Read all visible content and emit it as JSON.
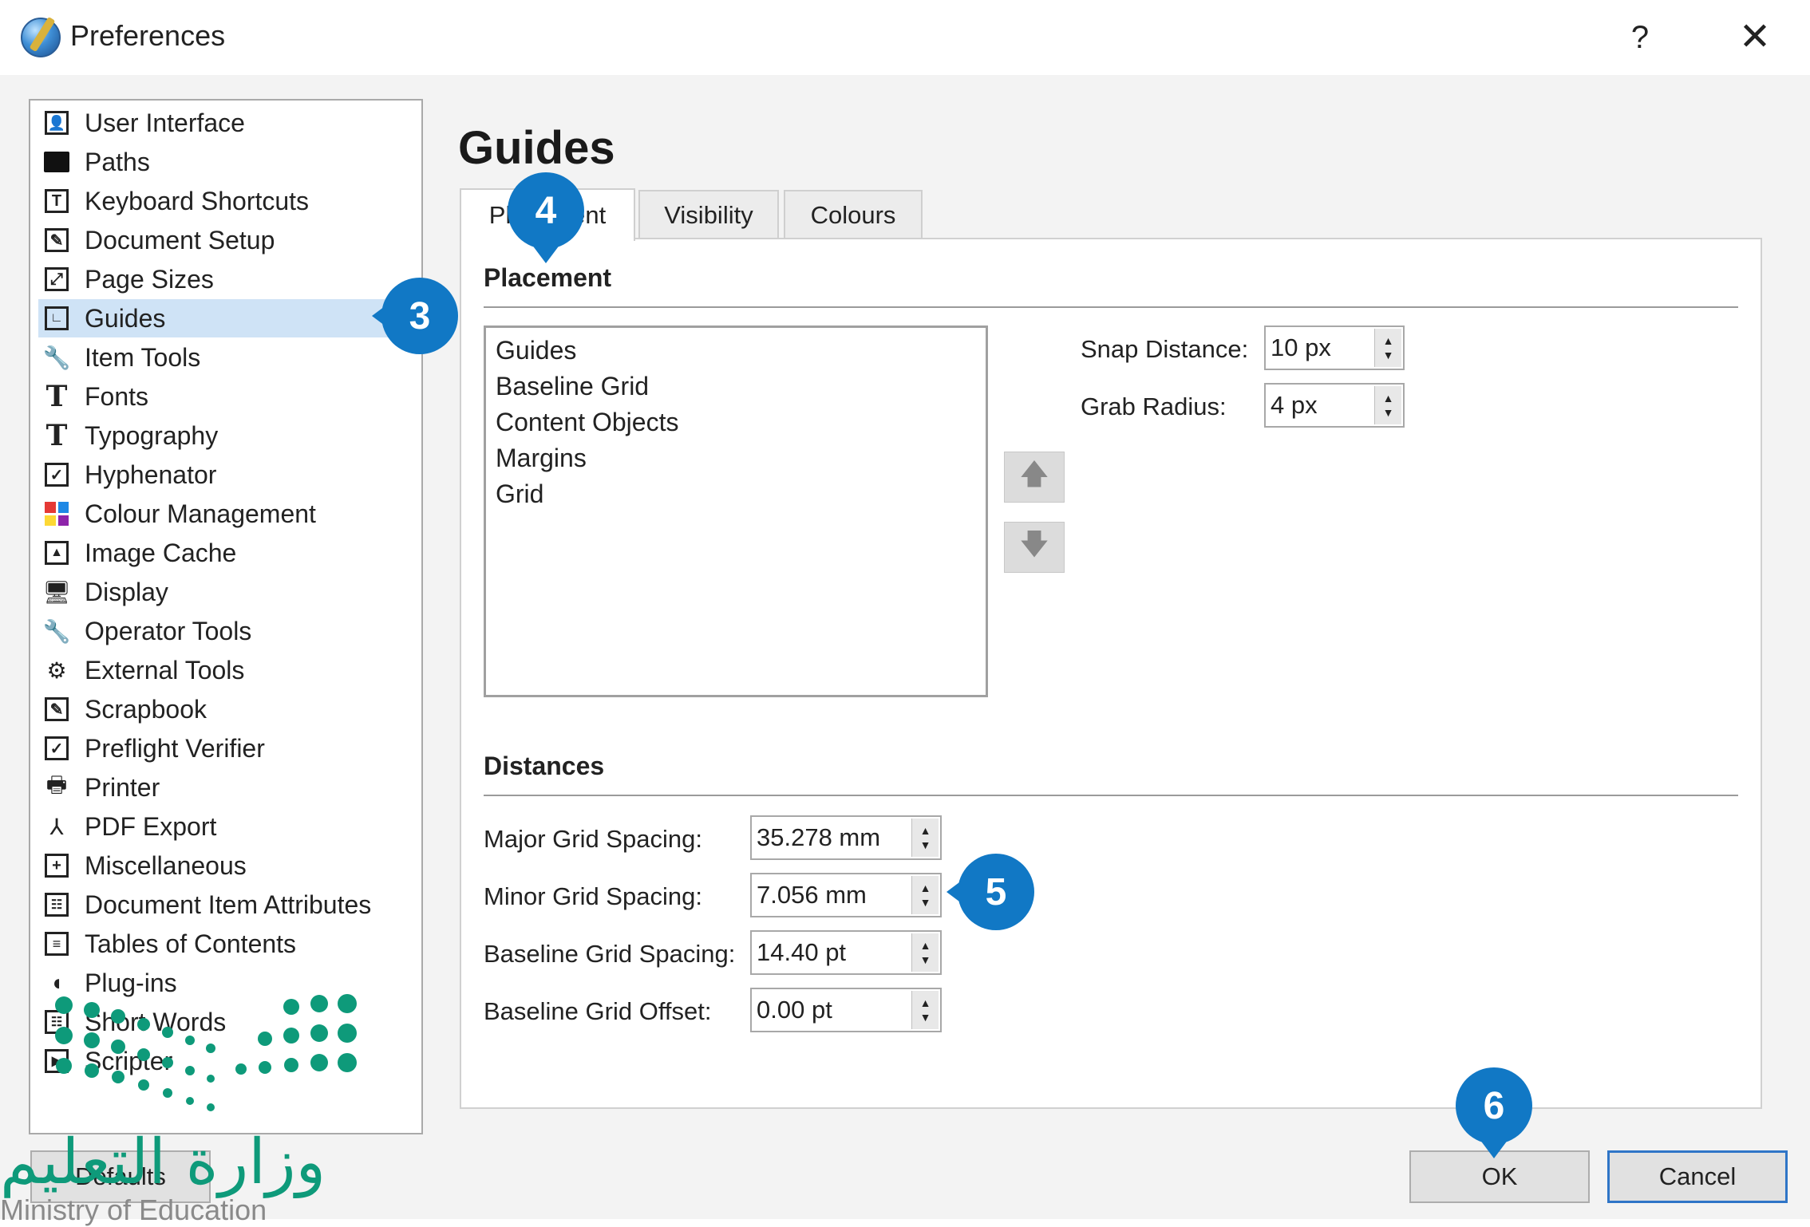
{
  "window": {
    "title": "Preferences",
    "help_glyph": "?",
    "close_glyph": "✕"
  },
  "sidebar": {
    "items": [
      {
        "label": "User Interface",
        "icon": "user-interface-icon"
      },
      {
        "label": "Paths",
        "icon": "folder-icon"
      },
      {
        "label": "Keyboard Shortcuts",
        "icon": "keyboard-icon"
      },
      {
        "label": "Document Setup",
        "icon": "document-setup-icon"
      },
      {
        "label": "Page Sizes",
        "icon": "page-sizes-icon"
      },
      {
        "label": "Guides",
        "icon": "guides-icon",
        "selected": true
      },
      {
        "label": "Item Tools",
        "icon": "wrench-icon"
      },
      {
        "label": "Fonts",
        "icon": "font-icon"
      },
      {
        "label": "Typography",
        "icon": "typography-icon"
      },
      {
        "label": "Hyphenator",
        "icon": "checkbox-icon"
      },
      {
        "label": "Colour Management",
        "icon": "colour-management-icon"
      },
      {
        "label": "Image Cache",
        "icon": "image-icon"
      },
      {
        "label": "Display",
        "icon": "display-icon"
      },
      {
        "label": "Operator Tools",
        "icon": "wrench-icon"
      },
      {
        "label": "External Tools",
        "icon": "gear-icon"
      },
      {
        "label": "Scrapbook",
        "icon": "scrapbook-icon"
      },
      {
        "label": "Preflight Verifier",
        "icon": "checkbox-icon"
      },
      {
        "label": "Printer",
        "icon": "printer-icon"
      },
      {
        "label": "PDF Export",
        "icon": "pdf-icon"
      },
      {
        "label": "Miscellaneous",
        "icon": "plus-box-icon"
      },
      {
        "label": "Document Item Attributes",
        "icon": "attributes-icon"
      },
      {
        "label": "Tables of Contents",
        "icon": "list-icon"
      },
      {
        "label": "Plug-ins",
        "icon": "plugin-icon"
      },
      {
        "label": "Short Words",
        "icon": "short-words-icon"
      },
      {
        "label": "Scripter",
        "icon": "scripter-icon"
      }
    ]
  },
  "main": {
    "heading": "Guides",
    "tabs": [
      {
        "label": "Placement",
        "active": true
      },
      {
        "label": "Visibility",
        "active": false
      },
      {
        "label": "Colours",
        "active": false
      }
    ],
    "placement": {
      "section_title": "Placement",
      "list_items": [
        "Guides",
        "Baseline Grid",
        "Content Objects",
        "Margins",
        "Grid"
      ],
      "move_up_glyph": "🡅",
      "move_down_glyph": "🡇",
      "snap_distance": {
        "label": "Snap Distance:",
        "value": "10 px"
      },
      "grab_radius": {
        "label": "Grab Radius:",
        "value": "4 px"
      }
    },
    "distances": {
      "section_title": "Distances",
      "major_grid_spacing": {
        "label": "Major Grid Spacing:",
        "value": "35.278 mm"
      },
      "minor_grid_spacing": {
        "label": "Minor Grid Spacing:",
        "value": "7.056 mm"
      },
      "baseline_grid_spacing": {
        "label": "Baseline Grid Spacing:",
        "value": "14.40 pt"
      },
      "baseline_grid_offset": {
        "label": "Baseline Grid Offset:",
        "value": "0.00 pt"
      }
    }
  },
  "buttons": {
    "defaults": "Defaults",
    "ok": "OK",
    "cancel": "Cancel"
  },
  "callouts": [
    "3",
    "4",
    "5",
    "6"
  ],
  "spin_glyphs": {
    "up": "▲",
    "down": "▼"
  },
  "watermark": {
    "arabic": "وزارة التعليم",
    "english": "Ministry of Education"
  },
  "colors": {
    "callout": "#1178c5",
    "selection": "#cfe3f6",
    "logo": "#0e9a7a"
  }
}
